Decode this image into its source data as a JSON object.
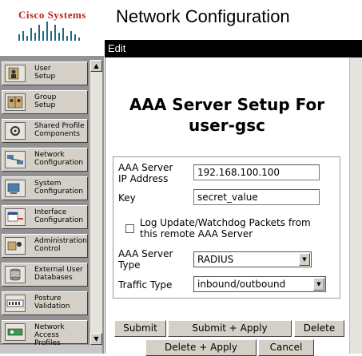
{
  "header": {
    "brand": "Cisco Systems",
    "title": "Network Configuration"
  },
  "nav": {
    "items": [
      {
        "label": "User\nSetup",
        "icon": "user-setup-icon"
      },
      {
        "label": "Group\nSetup",
        "icon": "group-setup-icon"
      },
      {
        "label": "Shared Profile\nComponents",
        "icon": "shared-profile-icon"
      },
      {
        "label": "Network\nConfiguration",
        "icon": "network-config-icon"
      },
      {
        "label": "System\nConfiguration",
        "icon": "system-config-icon"
      },
      {
        "label": "Interface\nConfiguration",
        "icon": "interface-config-icon"
      },
      {
        "label": "Administration\nControl",
        "icon": "admin-control-icon"
      },
      {
        "label": "External User\nDatabases",
        "icon": "external-db-icon"
      },
      {
        "label": "Posture\nValidation",
        "icon": "posture-icon"
      },
      {
        "label": "Network Access\nProfiles",
        "icon": "network-access-icon"
      }
    ]
  },
  "edit": {
    "bar_label": "Edit",
    "title_line1": "AAA Server Setup For",
    "title_line2": "user-gsc",
    "ip_label_1": "AAA Server",
    "ip_label_2": "IP Address",
    "ip_value": "192.168.100.100",
    "key_label": "Key",
    "key_value": "secret_value",
    "log_label_1": "Log Update/Watchdog Packets from",
    "log_label_2": "this remote AAA Server",
    "log_checked": false,
    "type_label_1": "AAA Server",
    "type_label_2": "Type",
    "type_value": "RADIUS",
    "traffic_label": "Traffic Type",
    "traffic_value": "inbound/outbound"
  },
  "buttons": {
    "submit": "Submit",
    "submit_apply": "Submit + Apply",
    "delete": "Delete",
    "delete_apply": "Delete + Apply",
    "cancel": "Cancel"
  },
  "colors": {
    "brand": "#b8241a",
    "nav_bg": "#929292",
    "button_face": "#d4d0c8",
    "edit_bar": "#000000"
  }
}
